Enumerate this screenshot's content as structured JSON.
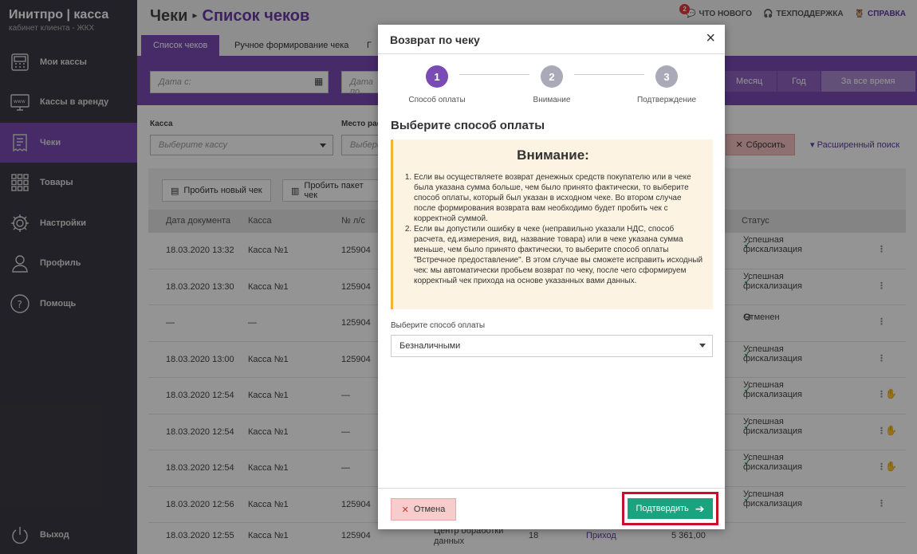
{
  "sidebar": {
    "logo_title": "Инитпро | касса",
    "logo_subtitle": "кабинет клиента - ЖКХ",
    "items": [
      {
        "label": "Мои кассы"
      },
      {
        "label": "Кассы в аренду"
      },
      {
        "label": "Чеки"
      },
      {
        "label": "Товары"
      },
      {
        "label": "Настройки"
      },
      {
        "label": "Профиль"
      },
      {
        "label": "Помощь"
      }
    ],
    "logout": "Выход"
  },
  "header": {
    "crumb_root": "Чеки",
    "crumb_current": "Список чеков",
    "news": "ЧТО НОВОГО",
    "news_badge": "2",
    "support": "ТЕХПОДДЕРЖКА",
    "help": "СПРАВКА"
  },
  "tabs": [
    "Список чеков",
    "Ручное формирование чека",
    "Г"
  ],
  "filters": {
    "date_from_placeholder": "Дата с:",
    "date_to_placeholder": "Дата по",
    "periods": [
      "Месяц",
      "Год",
      "За все время"
    ],
    "kassa_label": "Касса",
    "kassa_placeholder": "Выберите кассу",
    "place_label": "Место рас",
    "place_placeholder": "Выбери",
    "reset": "Сбросить",
    "advanced": "Расширенный поиск"
  },
  "toolbar": {
    "new_check": "Пробить новый чек",
    "batch_check": "Пробить пакет чек"
  },
  "table": {
    "headers": [
      "Дата документа",
      "Касса",
      "№ л/с",
      "Статус"
    ],
    "rows": [
      {
        "date": "18.03.2020 13:32",
        "kassa": "Касса №1",
        "ls": "125904",
        "status": "Успешная фискализация",
        "status_type": "ok"
      },
      {
        "date": "18.03.2020 13:30",
        "kassa": "Касса №1",
        "ls": "125904",
        "status": "Успешная фискализация",
        "status_type": "ok"
      },
      {
        "date": "—",
        "kassa": "—",
        "ls": "125904",
        "status": "Отменен",
        "status_type": "cancel"
      },
      {
        "date": "18.03.2020 13:00",
        "kassa": "Касса №1",
        "ls": "125904",
        "status": "Успешная фискализация",
        "status_type": "ok"
      },
      {
        "date": "18.03.2020 12:54",
        "kassa": "Касса №1",
        "ls": "—",
        "status": "Успешная фискализация",
        "status_type": "ok",
        "hand": true
      },
      {
        "date": "18.03.2020 12:54",
        "kassa": "Касса №1",
        "ls": "—",
        "status": "Успешная фискализация",
        "status_type": "ok",
        "hand": true
      },
      {
        "date": "18.03.2020 12:54",
        "kassa": "Касса №1",
        "ls": "—",
        "status": "Успешная фискализация",
        "status_type": "ok",
        "hand": true
      },
      {
        "date": "18.03.2020 12:56",
        "kassa": "Касса №1",
        "ls": "125904",
        "status": "Успешная фискализация",
        "status_type": "ok"
      }
    ],
    "last_row": {
      "date": "18.03.2020 12:55",
      "kassa": "Касса №1",
      "ls": "125904",
      "place": "Центр обработки данных",
      "count": "18",
      "type": "Приход",
      "sum": "5 361,00"
    }
  },
  "modal": {
    "title": "Возврат по чеку",
    "steps": [
      {
        "num": "1",
        "label": "Способ оплаты"
      },
      {
        "num": "2",
        "label": "Внимание"
      },
      {
        "num": "3",
        "label": "Подтверждение"
      }
    ],
    "heading": "Выберите способ оплаты",
    "warning_title": "Внимание:",
    "warning_items": [
      "Если вы осуществляете возврат денежных средств покупателю или в чеке была указана сумма больше, чем было принято фактически, то выберите способ оплаты, который был указан в исходном чеке. Во втором случае после формирования возврата вам необходимо будет пробить чек с корректной суммой.",
      "Если вы допустили ошибку в чеке (неправильно указали НДС, способ расчета, ед.измерения, вид, название товара) или в чеке указана сумма меньше, чем было принято фактически, то выберите способ оплаты \"Встречное предоставление\". В этом случае вы сможете исправить исходный чек: мы автоматически пробьем возврат по чеку, после чего сформируем корректный чек прихода на основе указанных вами данных."
    ],
    "pay_label": "Выберите способ оплаты",
    "pay_value": "Безналичными",
    "cancel": "Отмена",
    "confirm": "Подтвердить"
  }
}
